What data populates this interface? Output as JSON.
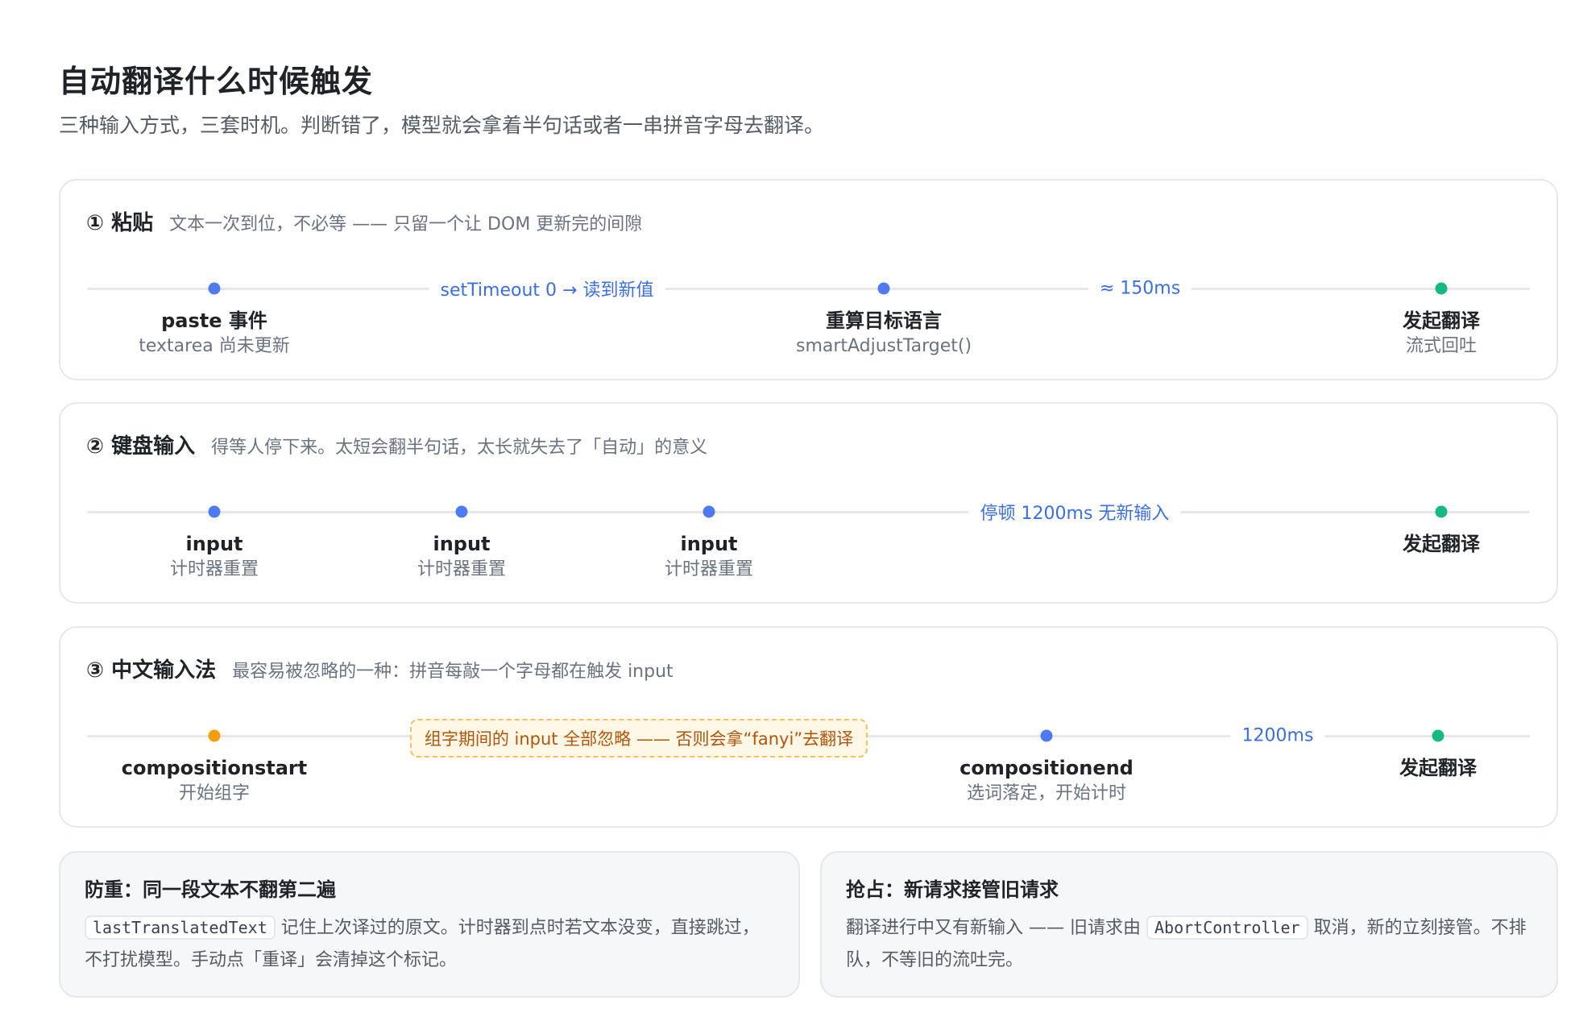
{
  "header": {
    "title": "自动翻译什么时候触发",
    "subtitle": "三种输入方式，三套时机。判断错了，模型就会拿着半句话或者一串拼音字母去翻译。"
  },
  "paste": {
    "title": "① 粘贴",
    "desc": "文本一次到位，不必等 —— 只留一个让 DOM 更新完的间隙",
    "gap1": "setTimeout 0 → 读到新值",
    "gap2": "≈ 150ms",
    "n1_main": "paste 事件",
    "n1_sub": "textarea 尚未更新",
    "n2_main": "重算目标语言",
    "n2_sub": "smartAdjustTarget()",
    "n3_main": "发起翻译",
    "n3_sub": "流式回吐"
  },
  "keyboard": {
    "title": "② 键盘输入",
    "desc": "得等人停下来。太短会翻半句话，太长就失去了「自动」的意义",
    "n1_main": "input",
    "n1_sub": "计时器重置",
    "n2_main": "input",
    "n2_sub": "计时器重置",
    "n3_main": "input",
    "n3_sub": "计时器重置",
    "gap": "停顿 1200ms 无新输入",
    "n4_main": "发起翻译"
  },
  "ime": {
    "title": "③ 中文输入法",
    "desc": "最容易被忽略的一种：拼音每敲一个字母都在触发 input",
    "n1_main": "compositionstart",
    "n1_sub": "开始组字",
    "warn": "组字期间的 input 全部忽略 —— 否则会拿“fanyi”去翻译",
    "n2_main": "compositionend",
    "n2_sub": "选词落定，开始计时",
    "gap": "1200ms",
    "n3_main": "发起翻译"
  },
  "note_dedupe": {
    "title": "防重：同一段文本不翻第二遍",
    "code": "lastTranslatedText",
    "text1": " 记住上次译过的原文。计时器到点时若文本没变，直接跳过，不打扰模型。手动点「重译」会清掉这个标记。"
  },
  "note_preempt": {
    "title": "抢占：新请求接管旧请求",
    "text0": "翻译进行中又有新输入 —— 旧请求由 ",
    "code": "AbortController",
    "text1": " 取消，新的立刻接管。不排队，不等旧的流吐完。"
  },
  "colors": {
    "blue": "#4f7bf2",
    "green": "#16b981",
    "orange": "#f59e0b",
    "label_blue": "#3b6fe0"
  }
}
